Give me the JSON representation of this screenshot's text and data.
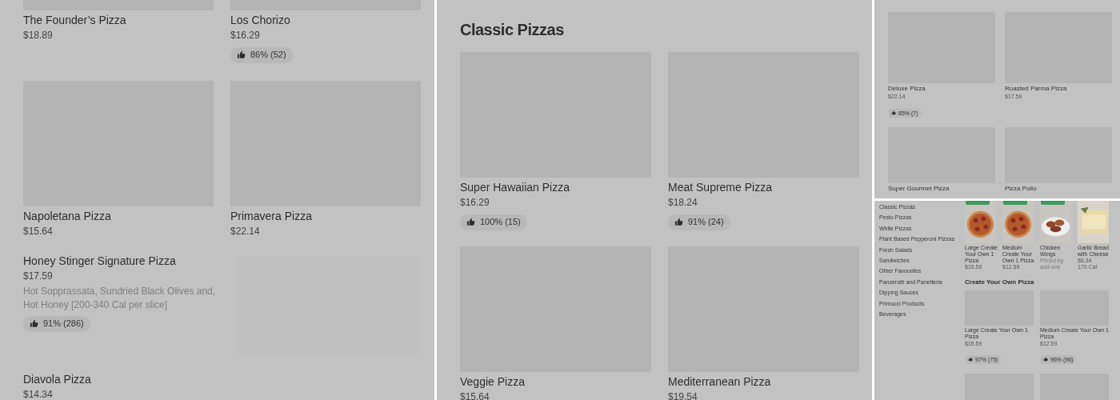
{
  "left_panel": {
    "items": [
      {
        "name": "The Founder’s Pizza",
        "price": "$18.89"
      },
      {
        "name": "Los Chorizo",
        "price": "$16.29",
        "rating": "86% (52)"
      },
      {
        "name": "Napoletana Pizza",
        "price": "$15.64"
      },
      {
        "name": "Primavera Pizza",
        "price": "$22.14"
      },
      {
        "name": "Honey Stinger Signature Pizza",
        "price": "$17.59",
        "description": "Hot Sopprassata, Sundried Black Olives and, Hot Honey [200-340 Cal per slice]",
        "rating": "91% (286)"
      },
      {
        "name": "Diavola Pizza",
        "price": "$14.34"
      }
    ]
  },
  "middle_panel": {
    "heading": "Classic Pizzas",
    "items": [
      {
        "name": "Super Hawaiian Pizza",
        "price": "$16.29",
        "rating": "100% (15)"
      },
      {
        "name": "Meat Supreme Pizza",
        "price": "$18.24",
        "rating": "91% (24)"
      },
      {
        "name": "Veggie Pizza",
        "price": "$15.64"
      },
      {
        "name": "Mediterranean Pizza",
        "price": "$19.54"
      }
    ]
  },
  "top_right_panel": {
    "items": [
      {
        "name": "Deluxe Pizza",
        "price": "$22.14",
        "rating": "85% (7)"
      },
      {
        "name": "Roasted Parma Pizza",
        "price": "$17.59"
      },
      {
        "name": "Super Gourmet Pizza"
      },
      {
        "name": "Pizza Pollo"
      }
    ]
  },
  "bottom_right_panel": {
    "categories": [
      "Classic Pizzas",
      "Pesto Pizzas",
      "White Pizzas",
      "Plant Based Pepperoni Pizzas",
      "Fresh Salads",
      "Sandwiches",
      "Other Favourites",
      "Panzerotti and Panetteria",
      "Dipping Sauces",
      "Primucci Products",
      "Beverages"
    ],
    "carousel": [
      {
        "name": "Large Create Your Own 1 Pizza",
        "price": "$15.59",
        "tag": true
      },
      {
        "name": "Medium Create Your Own 1 Pizza",
        "price": "$12.59",
        "tag": true
      },
      {
        "name": "Chicken Wings",
        "note": "Priced by add-ons",
        "tag": true
      },
      {
        "name": "Garlic Bread with Cheese",
        "price": "$6.34",
        "calories": "170 Cal",
        "tag": false
      }
    ],
    "section": {
      "heading": "Create Your Own Pizza",
      "items": [
        {
          "name": "Large Create Your Own 1 Pizza",
          "price": "$15.59",
          "rating": "97% (75)"
        },
        {
          "name": "Medium Create Your Own 1 Pizza",
          "price": "$12.59",
          "rating": "96% (96)"
        }
      ]
    }
  }
}
